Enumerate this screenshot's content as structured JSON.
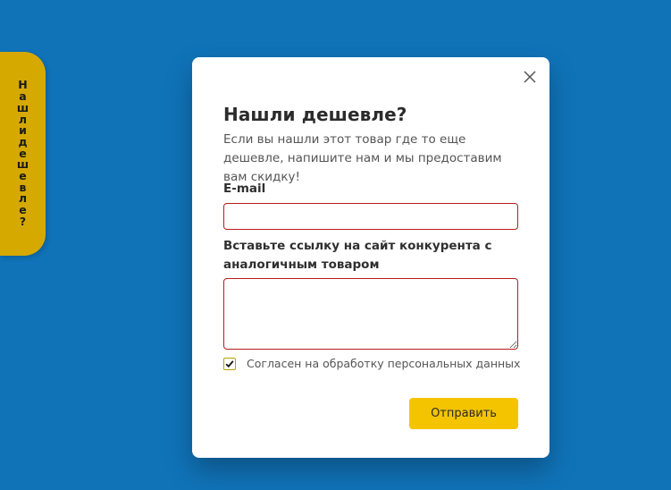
{
  "side_tab": {
    "label": "Нашли дешевле?"
  },
  "modal": {
    "title": "Нашли дешевле?",
    "subtitle": "Если вы нашли этот товар где то еще дешевле, напишите нам и мы предоставим вам скидку!",
    "email_label": "E-mail",
    "email_value": "",
    "link_label": "Вставьте ссылку на сайт конкурента с аналогичным товаром",
    "link_value": "",
    "consent_text": "Согласен на обработку персональных данных",
    "consent_checked": true,
    "submit_label": "Отправить"
  },
  "icons": {
    "close": "close-icon",
    "check": "checkmark-icon"
  },
  "colors": {
    "background": "#1073b8",
    "side_tab": "#d6a900",
    "submit_button": "#f5c400",
    "input_border": "#b71c1c"
  }
}
